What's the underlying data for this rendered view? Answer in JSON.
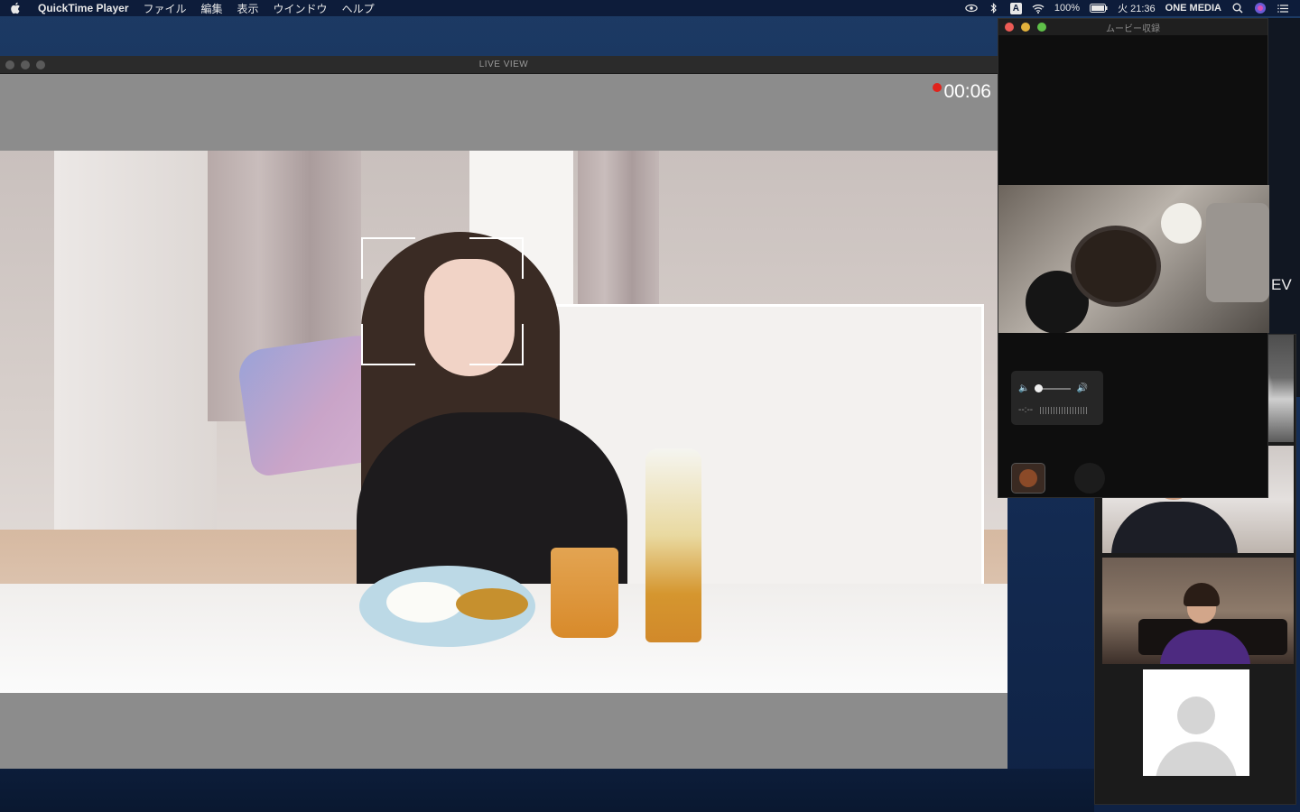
{
  "menubar": {
    "app_name": "QuickTime Player",
    "menus": [
      "ファイル",
      "編集",
      "表示",
      "ウインドウ",
      "ヘルプ"
    ],
    "status": {
      "ime": "A",
      "battery": "100%",
      "clock": "火 21:36",
      "user": "ONE MEDIA"
    }
  },
  "live_view": {
    "title": "LIVE VIEW",
    "recording_time": "00:06"
  },
  "movie_window": {
    "title": "ムービー収録",
    "time_display": "--:--"
  },
  "side_label": "EV",
  "colors": {
    "record": "#e0231c",
    "menubar": "#0d1c3a",
    "desktop": "#16305a"
  }
}
